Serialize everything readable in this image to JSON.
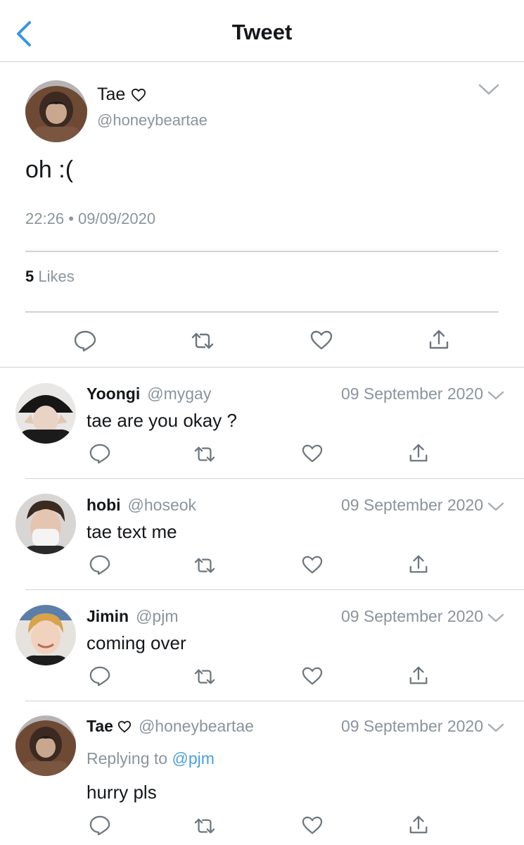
{
  "header": {
    "title": "Tweet"
  },
  "main_tweet": {
    "name": "Tae",
    "handle": "@honeybeartae",
    "text": "oh :(",
    "time": "22:26",
    "date": "09/09/2020",
    "likes_count": "5",
    "likes_label": "Likes"
  },
  "replies": [
    {
      "name": "Yoongi",
      "handle": "@mygay",
      "date": "09 September 2020",
      "text": "tae are you okay ?"
    },
    {
      "name": "hobi",
      "handle": "@hoseok",
      "date": "09 September 2020",
      "text": "tae text me"
    },
    {
      "name": "Jimin",
      "handle": "@pjm",
      "date": "09 September 2020",
      "text": "coming over"
    },
    {
      "name": "Tae",
      "handle": "@honeybeartae",
      "date": "09 September 2020",
      "replying_prefix": "Replying to",
      "replying_to": "@pjm",
      "text": "hurry pls"
    }
  ],
  "colors": {
    "accent": "#1da1f2",
    "link": "#4a9fe8",
    "muted": "#8a949d",
    "icon": "#6d7680",
    "divider": "#cfd3d7"
  }
}
